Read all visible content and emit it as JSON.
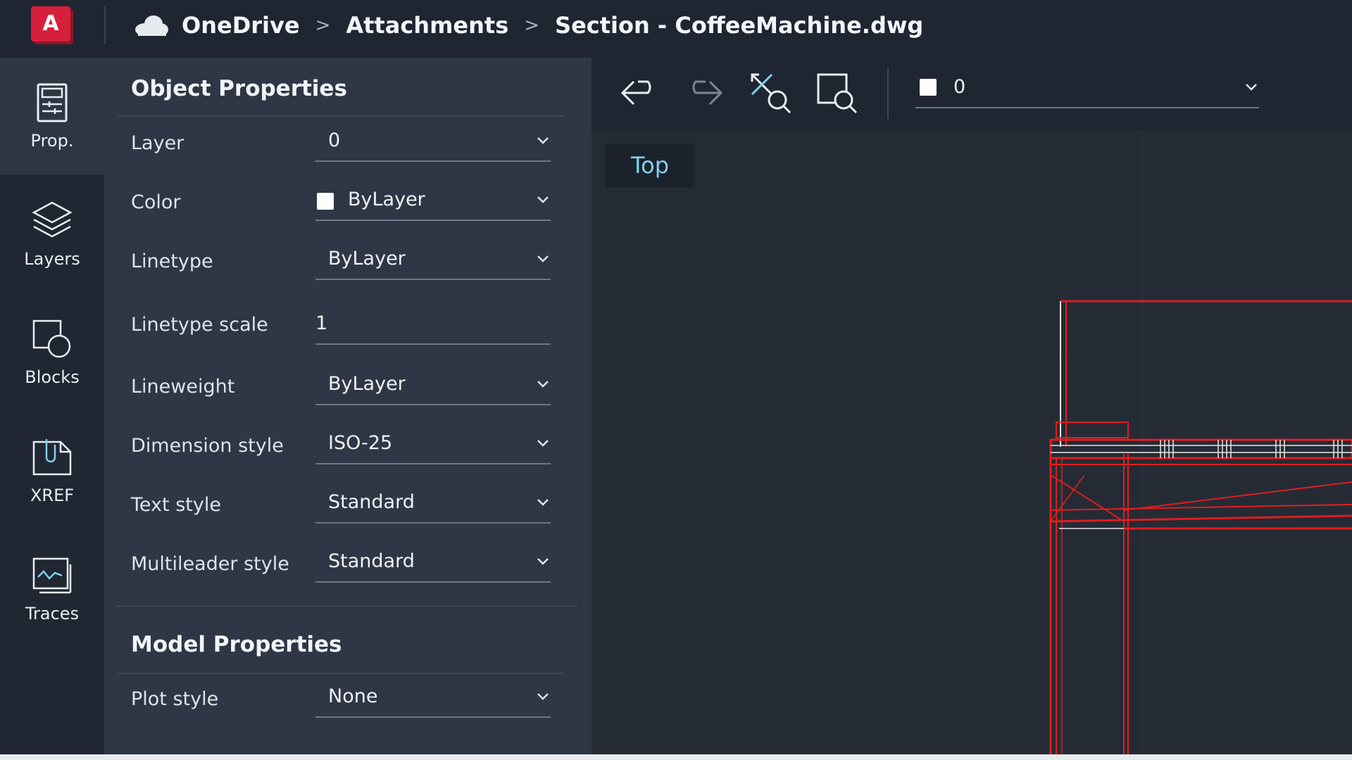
{
  "header": {
    "app_logo_letter": "A",
    "breadcrumb": [
      "OneDrive",
      "Attachments",
      "Section - CoffeeMachine.dwg"
    ],
    "separator": ">"
  },
  "rail": {
    "items": [
      {
        "label": "Prop.",
        "icon": "properties-icon",
        "active": true
      },
      {
        "label": "Layers",
        "icon": "layers-icon",
        "active": false
      },
      {
        "label": "Blocks",
        "icon": "blocks-icon",
        "active": false
      },
      {
        "label": "XREF",
        "icon": "xref-icon",
        "active": false
      },
      {
        "label": "Traces",
        "icon": "traces-icon",
        "active": false
      }
    ]
  },
  "object_properties": {
    "title": "Object Properties",
    "rows": [
      {
        "label": "Layer",
        "value": "0"
      },
      {
        "label": "Color",
        "value": "ByLayer"
      },
      {
        "label": "Linetype",
        "value": "ByLayer"
      },
      {
        "label": "Linetype scale",
        "value": "1"
      },
      {
        "label": "Lineweight",
        "value": "ByLayer"
      },
      {
        "label": "Dimension style",
        "value": "ISO-25"
      },
      {
        "label": "Text style",
        "value": "Standard"
      },
      {
        "label": "Multileader style",
        "value": "Standard"
      }
    ]
  },
  "model_properties": {
    "title": "Model Properties",
    "rows": [
      {
        "label": "Plot style",
        "value": "None"
      }
    ]
  },
  "toolbar": {
    "buttons": [
      "undo-icon",
      "redo-icon",
      "zoom-extents-icon",
      "zoom-window-icon"
    ],
    "current_layer": "0"
  },
  "viewport": {
    "view_label": "Top"
  },
  "colors": {
    "accent_red": "#d6203b",
    "drawing_red": "#e01e1e",
    "view_label": "#7fd0ec"
  }
}
